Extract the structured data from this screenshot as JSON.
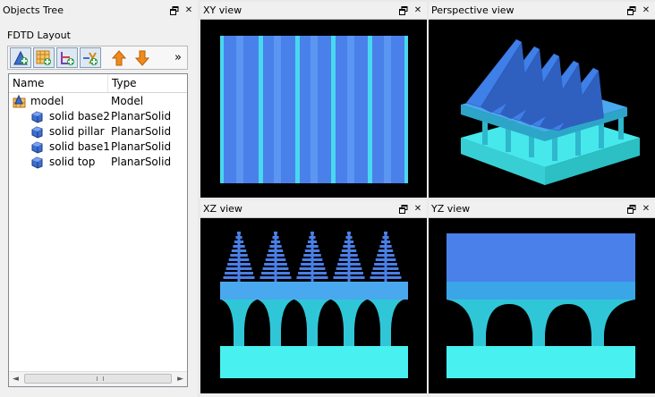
{
  "objects_tree": {
    "title": "Objects Tree",
    "layout_label": "FDTD Layout",
    "columns": {
      "name": "Name",
      "type": "Type"
    },
    "rows": [
      {
        "name": "model",
        "type": "Model"
      },
      {
        "name": "solid base2",
        "type": "PlanarSolid"
      },
      {
        "name": "solid pillar",
        "type": "PlanarSolid"
      },
      {
        "name": "solid base1",
        "type": "PlanarSolid"
      },
      {
        "name": "solid top",
        "type": "PlanarSolid"
      }
    ],
    "toolbar_more": "»",
    "scroll_left": "◄",
    "scroll_right": "►"
  },
  "views": {
    "xy": {
      "title": "XY view"
    },
    "perspective": {
      "title": "Perspective view"
    },
    "xz": {
      "title": "XZ view"
    },
    "yz": {
      "title": "YZ view"
    }
  },
  "panel_buttons": {
    "float": "float-icon",
    "close": "✕"
  },
  "colors": {
    "substrate": "#3ad6d6",
    "substrate_light": "#48f0ef",
    "blue": "#4a7fe6",
    "blue_light": "#5f9cf5",
    "background": "#000000"
  }
}
